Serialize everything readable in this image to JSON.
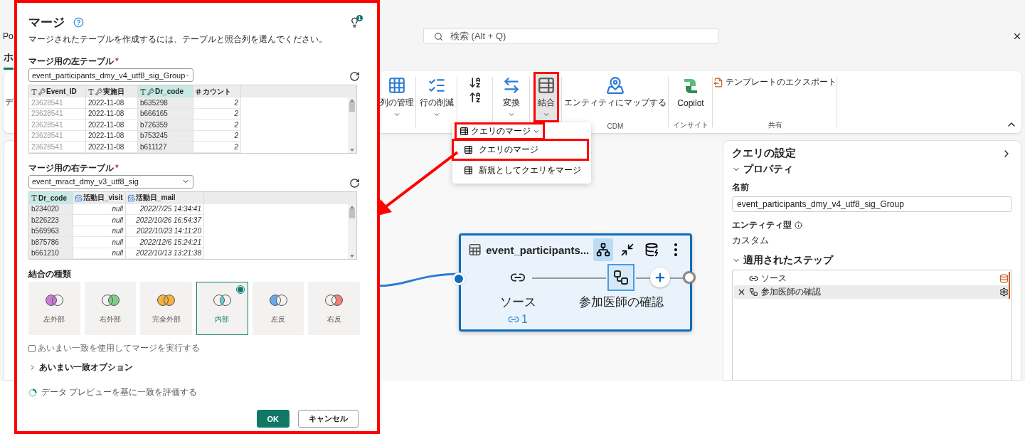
{
  "app": {
    "title": "Po",
    "search": {
      "placeholder": "検索 (Alt + Q)"
    },
    "tab": {
      "label": "ホ",
      "selected": true
    }
  },
  "ribbon": {
    "groups": [
      {
        "buttons": [
          {
            "kind": "cut",
            "label": "デ",
            "dropdown": false,
            "highlighted": false
          }
        ]
      },
      {
        "buttons": [
          {
            "kind": "manage_columns",
            "label": "列の管理",
            "dropdown": true,
            "highlighted": false
          }
        ]
      },
      {
        "buttons": [
          {
            "kind": "reduce_rows",
            "label": "行の削減",
            "dropdown": true,
            "highlighted": false
          }
        ]
      },
      {
        "buttons": [
          {
            "kind": "sort",
            "dropdown": false,
            "highlighted": false
          }
        ]
      },
      {
        "buttons": [
          {
            "kind": "transform",
            "label": "変換",
            "dropdown": true,
            "highlighted": false
          }
        ]
      },
      {
        "buttons": [
          {
            "kind": "combine",
            "label": "結合",
            "dropdown": true,
            "highlighted": true
          }
        ]
      },
      {
        "label": "CDM",
        "buttons": [
          {
            "kind": "map",
            "label": "エンティティにマップする",
            "dropdown": false,
            "highlighted": false
          }
        ]
      },
      {
        "label": "インサイト",
        "buttons": [
          {
            "kind": "copilot",
            "label": "Copilot",
            "dropdown": false,
            "highlighted": false
          }
        ]
      },
      {
        "label": "共有",
        "buttons": [
          {
            "kind": "export",
            "label": "テンプレートのエクスポート",
            "dropdown": false,
            "highlighted": false
          }
        ]
      }
    ]
  },
  "merge_menu": {
    "header": {
      "label": "クエリのマージ",
      "highlighted": true
    },
    "items": [
      {
        "label": "クエリのマージ",
        "highlighted": true
      },
      {
        "label": "新規としてクエリをマージ",
        "highlighted": false
      }
    ]
  },
  "node": {
    "title": "event_participants...",
    "actions": [
      {
        "kind": "diagram",
        "selected": true
      },
      {
        "kind": "collapse",
        "selected": false
      },
      {
        "kind": "database",
        "selected": false
      },
      {
        "kind": "more",
        "selected": false
      }
    ],
    "steps": [
      {
        "kind": "source",
        "label": "ソース",
        "selected": false,
        "link_count": "1"
      },
      {
        "kind": "step",
        "label": "参加医師の確認",
        "selected": true
      }
    ]
  },
  "settings": {
    "title": "クエリの設定",
    "properties": {
      "label": "プロパティ",
      "expanded": true,
      "name_label": "名前",
      "name_value": "event_participants_dmy_v4_utf8_sig_Group",
      "entity_label": "エンティティ型",
      "entity_value": "カスタム"
    },
    "steps": {
      "label": "適用されたステップ",
      "expanded": true,
      "items": [
        {
          "kind": "source",
          "label": "ソース",
          "selected": false
        },
        {
          "kind": "step",
          "label": "参加医師の確認",
          "selected": true
        }
      ]
    }
  },
  "dialog": {
    "title": "マージ",
    "hint_count": "1",
    "description": "マージされたテーブルを作成するには、テーブルと照合列を選んでください。",
    "tables": [
      {
        "label": "マージ用の左テーブル",
        "required_mark": "*",
        "value": "event_participants_dmy_v4_utf8_sig_Group",
        "columns": [
          {
            "name": "Event_ID",
            "kind": "text",
            "key": true,
            "selected": false
          },
          {
            "name": "実施日",
            "kind": "text",
            "key": true,
            "selected": false
          },
          {
            "name": "Dr_code",
            "kind": "text",
            "key": true,
            "selected": true
          },
          {
            "name": "カウント",
            "kind": "number",
            "key": false,
            "selected": false
          }
        ],
        "rows": [
          [
            "23628541",
            "2022-11-08",
            "b635298",
            "2"
          ],
          [
            "23628541",
            "2022-11-08",
            "b666165",
            "2"
          ],
          [
            "23628541",
            "2022-11-08",
            "b726359",
            "2"
          ],
          [
            "23628541",
            "2022-11-08",
            "b753245",
            "2"
          ],
          [
            "23628541",
            "2022-11-08",
            "b611127",
            "2"
          ]
        ]
      },
      {
        "label": "マージ用の右テーブル",
        "required_mark": "*",
        "value": "event_mract_dmy_v3_utf8_sig",
        "columns": [
          {
            "name": "Dr_code",
            "kind": "text",
            "key": false,
            "selected": true
          },
          {
            "name": "活動日_visit",
            "kind": "datetime",
            "key": false,
            "selected": false
          },
          {
            "name": "活動日_mail",
            "kind": "datetime",
            "key": false,
            "selected": false
          }
        ],
        "rows": [
          [
            "b234020",
            "null",
            "2022/7/25 14:34:41"
          ],
          [
            "b226223",
            "null",
            "2022/10/26 16:54:37"
          ],
          [
            "b569963",
            "null",
            "2022/10/23 14:11:20"
          ],
          [
            "b875786",
            "null",
            "2022/12/6 15:24:21"
          ],
          [
            "b661210",
            "null",
            "2022/10/13 13:21:38"
          ]
        ]
      }
    ],
    "join_kind": {
      "label": "結合の種類",
      "options": [
        {
          "kind": "left_outer",
          "label": "左外部",
          "color": "#c77dd6",
          "selected": false
        },
        {
          "kind": "right_outer",
          "label": "右外部",
          "color": "#7fcf8a",
          "selected": false
        },
        {
          "kind": "full_outer",
          "label": "完全外部",
          "color": "#f5b041",
          "selected": false
        },
        {
          "kind": "inner",
          "label": "内部",
          "color": "#5fd3cf",
          "selected": true
        },
        {
          "kind": "left_anti",
          "label": "左反",
          "color": "#6aa9e9",
          "selected": false
        },
        {
          "kind": "right_anti",
          "label": "右反",
          "color": "#f07f7f",
          "selected": false
        }
      ]
    },
    "fuzzy": {
      "label": "あいまい一致を使用してマージを実行する",
      "checked": false
    },
    "fuzzy_options": {
      "label": "あいまい一致オプション",
      "expanded": false
    },
    "status": {
      "label": "データ プレビューを基に一致を評価する",
      "loading": true
    },
    "buttons": [
      {
        "kind": "primary",
        "label": "OK"
      },
      {
        "kind": "secondary",
        "label": "キャンセル"
      }
    ]
  }
}
